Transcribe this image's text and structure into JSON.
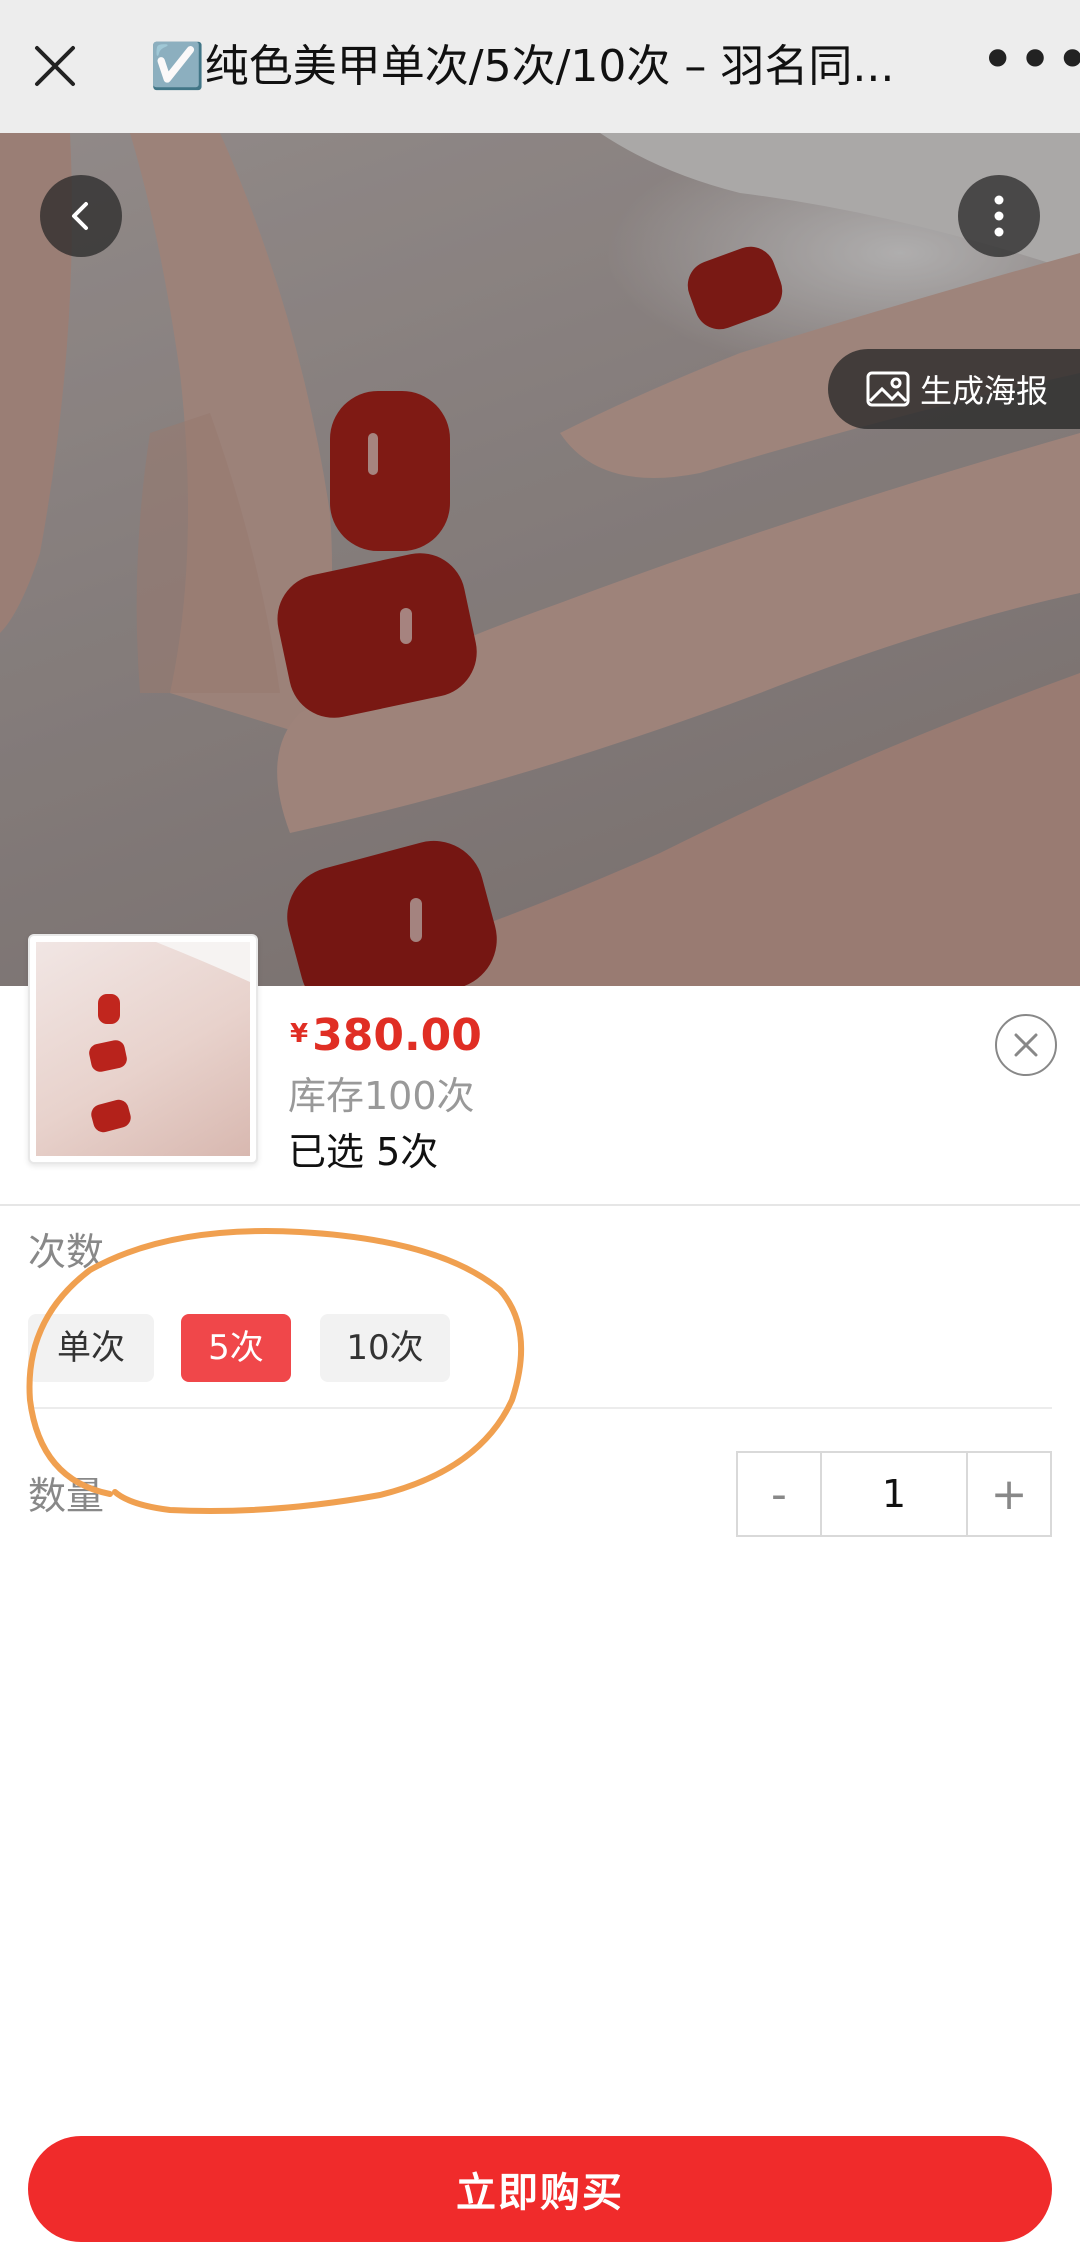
{
  "topbar": {
    "title": "☑️纯色美甲单次/5次/10次 – 羽名同...",
    "more_label": "•••"
  },
  "hero": {
    "poster_label": "生成海报"
  },
  "product": {
    "currency": "¥",
    "price": "380.00",
    "stock": "库存100次",
    "selected": "已选 5次"
  },
  "options": {
    "label": "次数",
    "items": [
      {
        "label": "单次",
        "active": false
      },
      {
        "label": "5次",
        "active": true
      },
      {
        "label": "10次",
        "active": false
      }
    ]
  },
  "quantity": {
    "label": "数量",
    "minus": "-",
    "value": "1",
    "plus": "+"
  },
  "buy_label": "立即购买",
  "colors": {
    "accent": "#f02b2b",
    "price": "#e02e24",
    "option_active": "#f0474a",
    "annotation": "#f0a050"
  }
}
